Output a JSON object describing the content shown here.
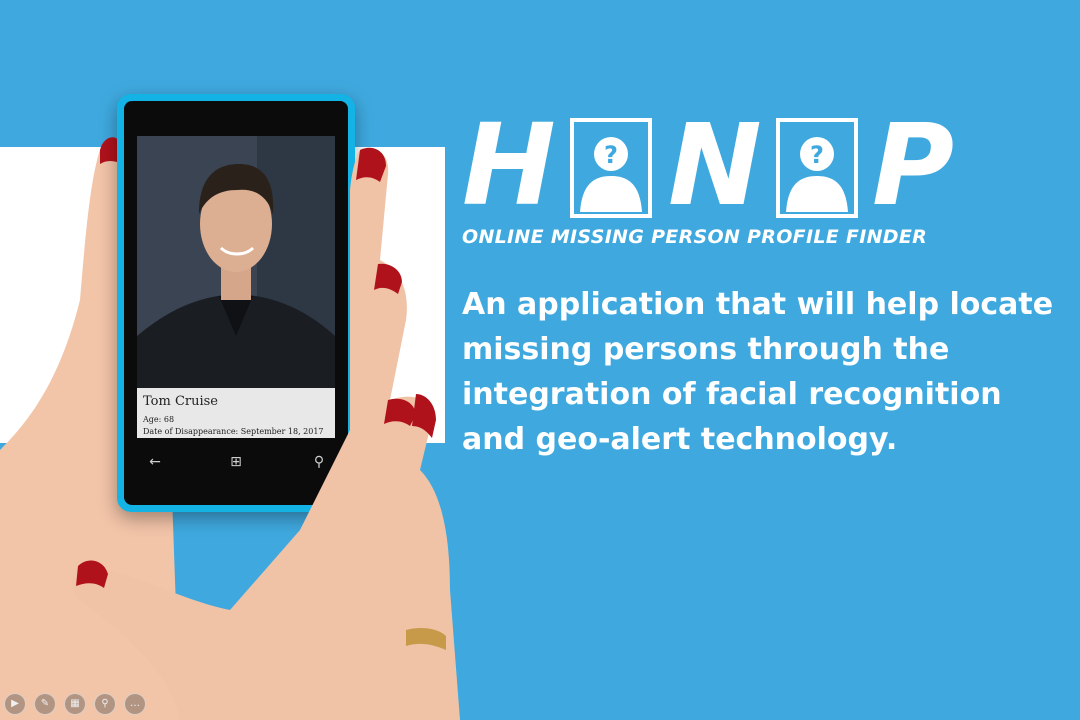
{
  "brand": {
    "letters": [
      "H",
      "N",
      "P"
    ],
    "tagline": "ONLINE MISSING PERSON PROFILE FINDER"
  },
  "description": "An application that will help locate missing persons through the integration of facial recognition and geo-alert technology.",
  "phone": {
    "profile": {
      "name": "Tom Cruise",
      "age": "Age: 68",
      "disappearance": "Date of Disappearance: September 18, 2017"
    },
    "softkeys": [
      {
        "icon": "back-arrow-icon",
        "glyph": "←"
      },
      {
        "icon": "windows-logo-icon",
        "glyph": "⊞"
      },
      {
        "icon": "search-icon",
        "glyph": "⚲"
      }
    ]
  },
  "toolbar": {
    "buttons": [
      {
        "icon": "play-icon",
        "glyph": "▶"
      },
      {
        "icon": "pen-icon",
        "glyph": "✎"
      },
      {
        "icon": "slides-icon",
        "glyph": "▦"
      },
      {
        "icon": "zoom-icon",
        "glyph": "⚲"
      },
      {
        "icon": "more-icon",
        "glyph": "…"
      }
    ]
  },
  "colors": {
    "background": "#3fa9df",
    "phone_body": "#14b3e6",
    "nail": "#b0121c"
  }
}
